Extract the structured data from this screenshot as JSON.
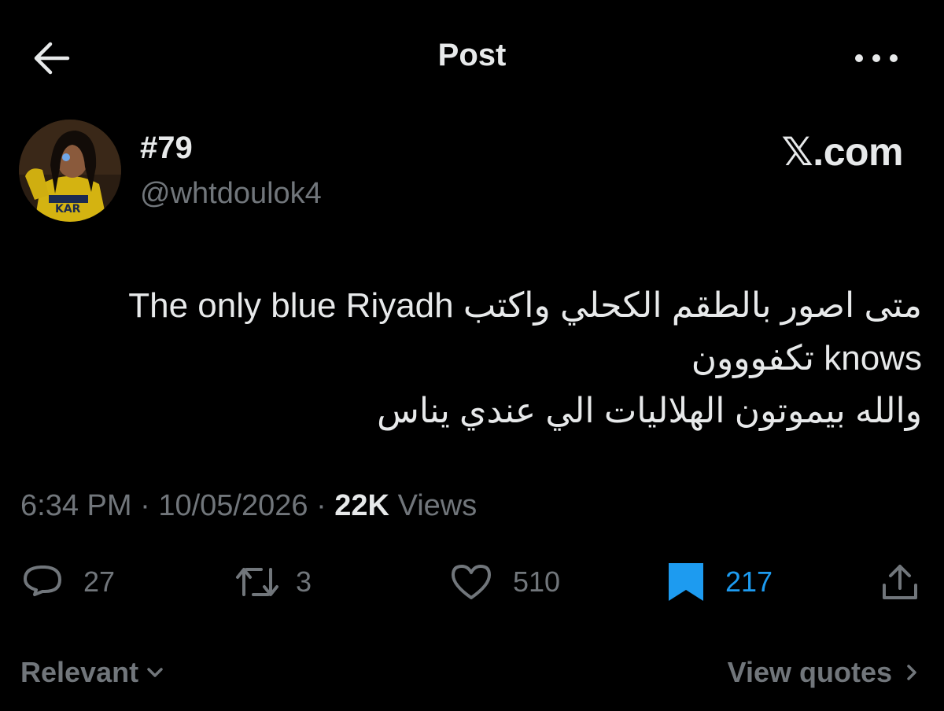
{
  "header": {
    "title": "Post",
    "back_icon": "arrow-left-icon",
    "more_icon": "more-horizontal-icon"
  },
  "author": {
    "display_name": "#79",
    "handle": "@whtdoulok4"
  },
  "watermark": "𝕏.com",
  "post": {
    "lines": [
      "متى اصور بالطقم الكحلي واكتب The only blue Riyadh",
      "knows تكفووون",
      "والله بيموتون الهلاليات الي عندي يناس"
    ]
  },
  "meta": {
    "time": "6:34 PM",
    "separator": "·",
    "date": "10/05/2026",
    "views_count": "22K",
    "views_label": "Views"
  },
  "actions": {
    "replies": "27",
    "reposts": "3",
    "likes": "510",
    "bookmarks": "217"
  },
  "footer": {
    "sort_label": "Relevant",
    "view_quotes_label": "View quotes"
  },
  "colors": {
    "background": "#000000",
    "text": "#e7e9ea",
    "muted": "#71767b",
    "accent": "#1d9bf0"
  }
}
